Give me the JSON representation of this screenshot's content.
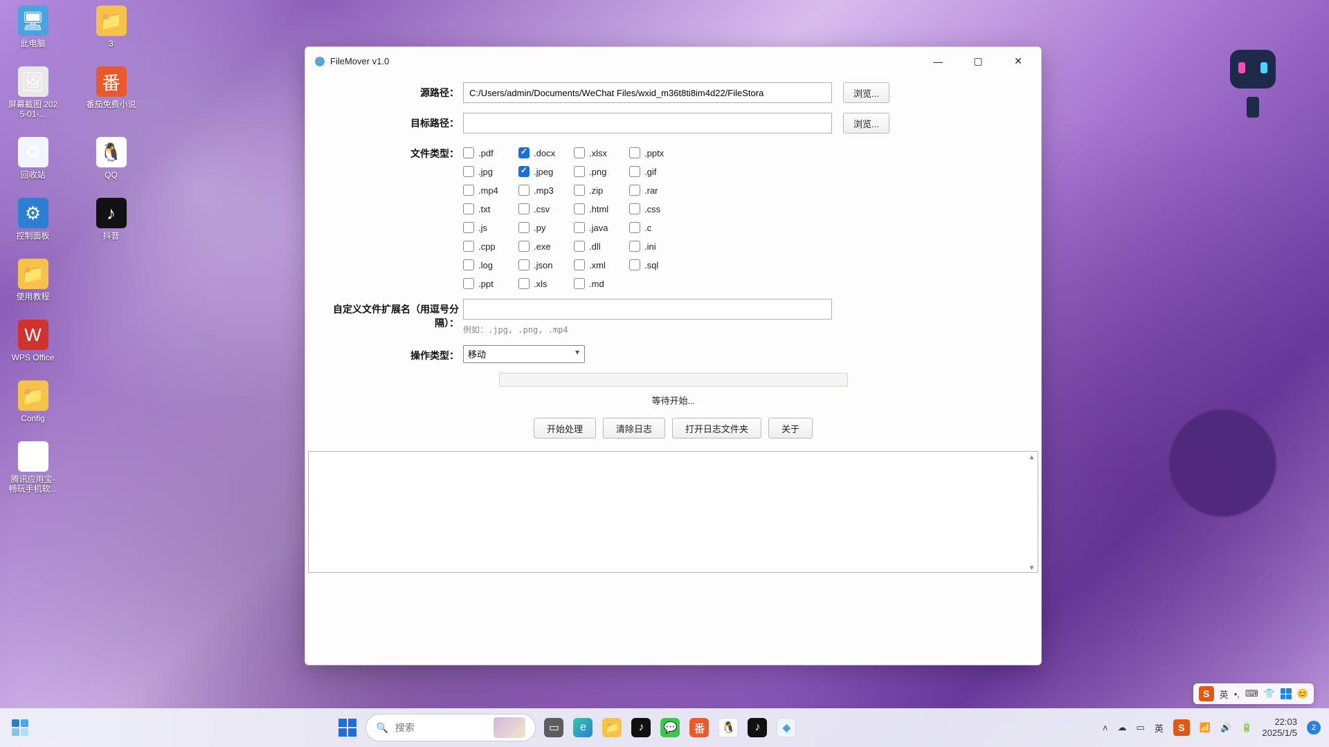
{
  "desktop": {
    "icons": [
      {
        "id": "this-pc",
        "label": "此电脑",
        "glyph": "g-pc",
        "sym": "🖥"
      },
      {
        "id": "folder-3",
        "label": "3",
        "glyph": "g-fold",
        "sym": "📁"
      },
      {
        "id": "screenshot",
        "label": "屏幕截图 2025-01-...",
        "glyph": "g-snap",
        "sym": "🖼"
      },
      {
        "id": "tomato",
        "label": "番茄免费小说",
        "glyph": "g-tom",
        "sym": "番"
      },
      {
        "id": "recycle-bin",
        "label": "回收站",
        "glyph": "g-bin",
        "sym": "♻"
      },
      {
        "id": "qq",
        "label": "QQ",
        "glyph": "g-qq",
        "sym": "🐧"
      },
      {
        "id": "control-panel",
        "label": "控制面板",
        "glyph": "g-cp",
        "sym": "⚙"
      },
      {
        "id": "douyin",
        "label": "抖音",
        "glyph": "g-dy",
        "sym": "♪"
      },
      {
        "id": "use-guide",
        "label": "使用教程",
        "glyph": "g-fold",
        "sym": "📁"
      },
      {
        "id": "wps",
        "label": "WPS Office",
        "glyph": "g-wps",
        "sym": "W"
      },
      {
        "id": "config",
        "label": "Config",
        "glyph": "g-fold",
        "sym": "📁"
      },
      {
        "id": "tx-app",
        "label": "腾讯应用宝-畅玩手机软...",
        "glyph": "g-txyy",
        "sym": "◑"
      }
    ]
  },
  "window": {
    "title": "FileMover v1.0",
    "labels": {
      "source": "源路径：",
      "target": "目标路径：",
      "filetype": "文件类型：",
      "custom_ext": "自定义文件扩展名（用逗号分隔）：",
      "op_type": "操作类型："
    },
    "source_value": "C:/Users/admin/Documents/WeChat Files/wxid_m36t8ti8im4d22/FileStora",
    "target_value": "",
    "browse": "浏览...",
    "custom_ext_value": "",
    "custom_ext_hint": "例如：.jpg, .png, .mp4",
    "op_value": "移动",
    "status": "等待开始...",
    "buttons": {
      "start": "开始处理",
      "clear": "清除日志",
      "open_log": "打开日志文件夹",
      "about": "关于"
    },
    "file_types": [
      [
        {
          "ext": ".pdf",
          "checked": false
        },
        {
          "ext": ".docx",
          "checked": true
        },
        {
          "ext": ".xlsx",
          "checked": false
        },
        {
          "ext": ".pptx",
          "checked": false
        }
      ],
      [
        {
          "ext": ".jpg",
          "checked": false
        },
        {
          "ext": ".jpeg",
          "checked": true
        },
        {
          "ext": ".png",
          "checked": false
        },
        {
          "ext": ".gif",
          "checked": false
        }
      ],
      [
        {
          "ext": ".mp4",
          "checked": false
        },
        {
          "ext": ".mp3",
          "checked": false
        },
        {
          "ext": ".zip",
          "checked": false
        },
        {
          "ext": ".rar",
          "checked": false
        }
      ],
      [
        {
          "ext": ".txt",
          "checked": false
        },
        {
          "ext": ".csv",
          "checked": false
        },
        {
          "ext": ".html",
          "checked": false
        },
        {
          "ext": ".css",
          "checked": false
        }
      ],
      [
        {
          "ext": ".js",
          "checked": false
        },
        {
          "ext": ".py",
          "checked": false
        },
        {
          "ext": ".java",
          "checked": false
        },
        {
          "ext": ".c",
          "checked": false
        }
      ],
      [
        {
          "ext": ".cpp",
          "checked": false
        },
        {
          "ext": ".exe",
          "checked": false
        },
        {
          "ext": ".dll",
          "checked": false
        },
        {
          "ext": ".ini",
          "checked": false
        }
      ],
      [
        {
          "ext": ".log",
          "checked": false
        },
        {
          "ext": ".json",
          "checked": false
        },
        {
          "ext": ".xml",
          "checked": false
        },
        {
          "ext": ".sql",
          "checked": false
        }
      ],
      [
        {
          "ext": ".ppt",
          "checked": false
        },
        {
          "ext": ".xls",
          "checked": false
        },
        {
          "ext": ".md",
          "checked": false
        }
      ]
    ]
  },
  "taskbar": {
    "search_placeholder": "搜索",
    "tray": {
      "ime": "英",
      "battery": "🔋",
      "wifi": "📶",
      "volume": "🔊"
    },
    "time": "22:03",
    "date": "2025/1/5",
    "notifications": "2",
    "apps": [
      {
        "id": "taskview",
        "glyph": "tg-taskview",
        "sym": "▭"
      },
      {
        "id": "edge",
        "glyph": "tg-edge",
        "sym": "e"
      },
      {
        "id": "explorer",
        "glyph": "tg-explorer",
        "sym": "📁"
      },
      {
        "id": "douyin",
        "glyph": "tg-douyin",
        "sym": "♪"
      },
      {
        "id": "wechat",
        "glyph": "tg-wechat",
        "sym": "💬"
      },
      {
        "id": "tomato",
        "glyph": "tg-tomato",
        "sym": "番"
      },
      {
        "id": "qq",
        "glyph": "tg-qq",
        "sym": "🐧"
      },
      {
        "id": "douyin2",
        "glyph": "tg-dy2",
        "sym": "♪"
      },
      {
        "id": "filemover",
        "glyph": "tg-app",
        "sym": "◆"
      }
    ]
  },
  "ime_bar": {
    "lang": "英",
    "dot": "•,"
  }
}
